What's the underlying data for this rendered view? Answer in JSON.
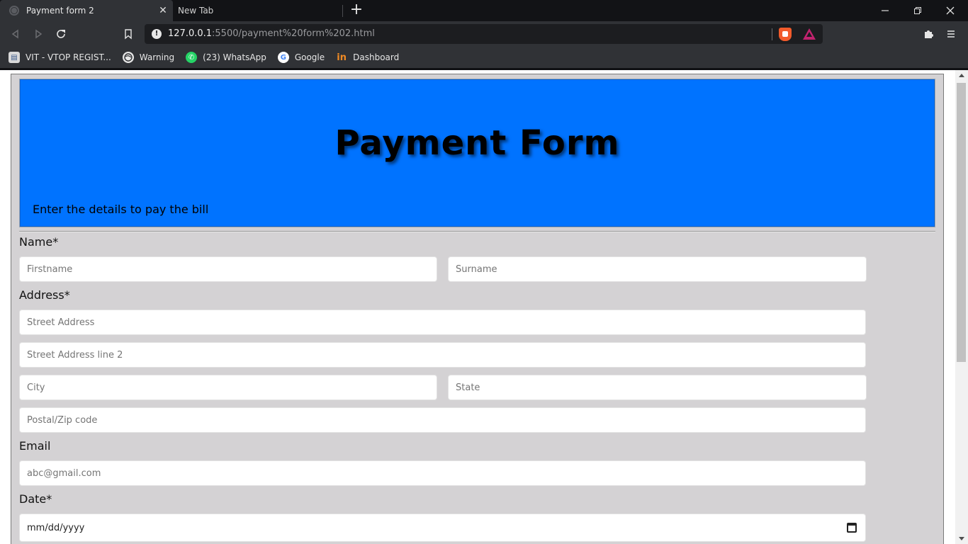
{
  "browser": {
    "tabs": [
      {
        "title": "Payment form 2",
        "active": true
      },
      {
        "title": "New Tab",
        "active": false
      }
    ],
    "new_tab_glyph": "+",
    "url_host": "127.0.0.1",
    "url_path": ":5500/payment%20form%202.html",
    "bookmarks": [
      {
        "label": "VIT - VTOP REGIST...",
        "icon": "vtop-icon"
      },
      {
        "label": "Warning",
        "icon": "globe-icon"
      },
      {
        "label": "(23) WhatsApp",
        "icon": "whatsapp-icon"
      },
      {
        "label": "Google",
        "icon": "google-icon"
      },
      {
        "label": "Dashboard",
        "icon": "invision-icon"
      }
    ],
    "colors": {
      "frame": "#121316",
      "toolbar": "#303236",
      "omnibox": "#1c1d20"
    }
  },
  "page": {
    "header": {
      "title": "Payment Form",
      "subtitle": "Enter the details to pay the bill",
      "bg_color": "#0073ff"
    },
    "form": {
      "name_label": "Name*",
      "firstname_placeholder": "Firstname",
      "surname_placeholder": "Surname",
      "address_label": "Address*",
      "street_placeholder": "Street Address",
      "street2_placeholder": "Street Address line 2",
      "city_placeholder": "City",
      "state_placeholder": "State",
      "zip_placeholder": "Postal/Zip code",
      "email_label": "Email",
      "email_placeholder": "abc@gmail.com",
      "date_label": "Date*",
      "date_value": "mm/dd/yyyy",
      "bg_color": "#d4d2d4"
    }
  }
}
